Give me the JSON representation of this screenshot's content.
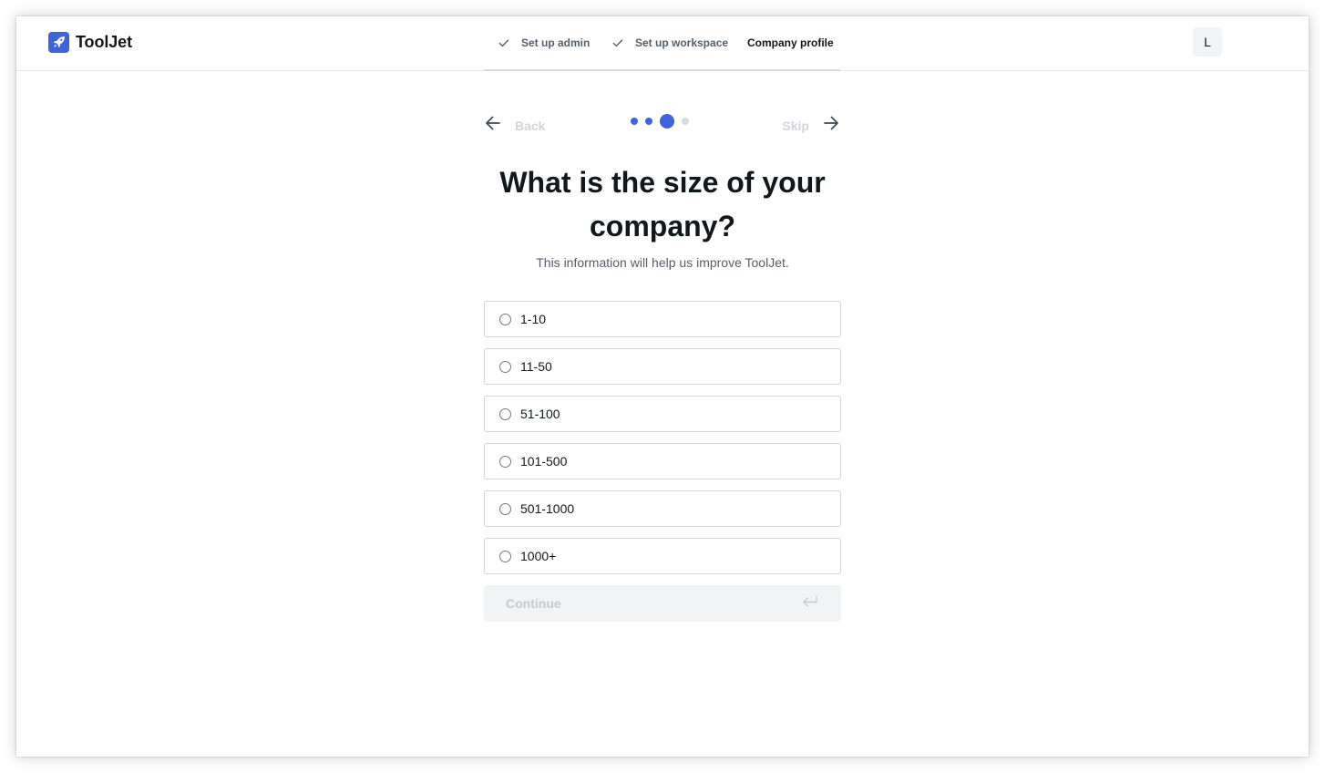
{
  "app": {
    "name": "ToolJet"
  },
  "header": {
    "steps": [
      {
        "label": "Set up admin",
        "done": true
      },
      {
        "label": "Set up workspace",
        "done": true
      },
      {
        "label": "Company profile",
        "done": false,
        "active": true
      }
    ],
    "avatar_initial": "L"
  },
  "nav": {
    "back_label": "Back",
    "skip_label": "Skip",
    "progress": {
      "total": 4,
      "current": 3
    }
  },
  "question": {
    "title": "What is the size of your company?",
    "subtitle": "This information will help us improve ToolJet."
  },
  "options": [
    {
      "label": "1-10",
      "selected": false
    },
    {
      "label": "11-50",
      "selected": false
    },
    {
      "label": "51-100",
      "selected": false
    },
    {
      "label": "101-500",
      "selected": false
    },
    {
      "label": "501-1000",
      "selected": false
    },
    {
      "label": "1000+",
      "selected": false
    }
  ],
  "continue": {
    "label": "Continue",
    "disabled": true
  },
  "colors": {
    "brand": "#3e63dd",
    "progress_active": "#3e63dd",
    "progress_inactive": "#d7dbdf"
  },
  "icons": {
    "logo": "rocket-icon",
    "step_done": "check-icon",
    "back": "arrow-left-icon",
    "skip": "arrow-right-icon",
    "continue": "enter-return-icon"
  }
}
